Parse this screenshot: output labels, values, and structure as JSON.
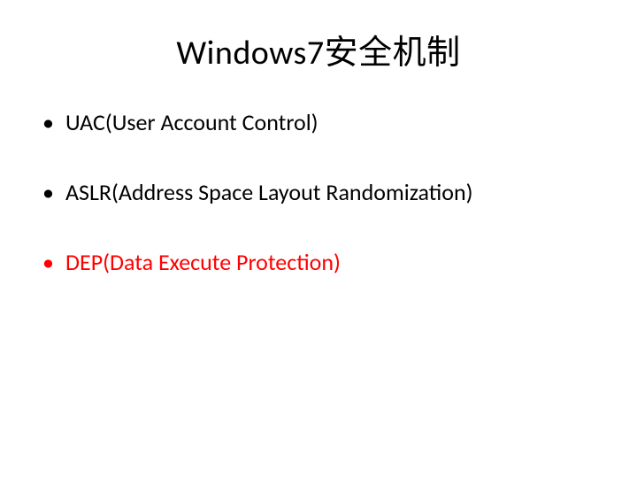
{
  "slide": {
    "title": "Windows7安全机制",
    "bullets": [
      {
        "text": "UAC(User Account Control)",
        "colorClass": ""
      },
      {
        "text": "ASLR(Address Space Layout Randomization)",
        "colorClass": ""
      },
      {
        "text": "DEP(Data Execute Protection)",
        "colorClass": "red"
      }
    ]
  }
}
